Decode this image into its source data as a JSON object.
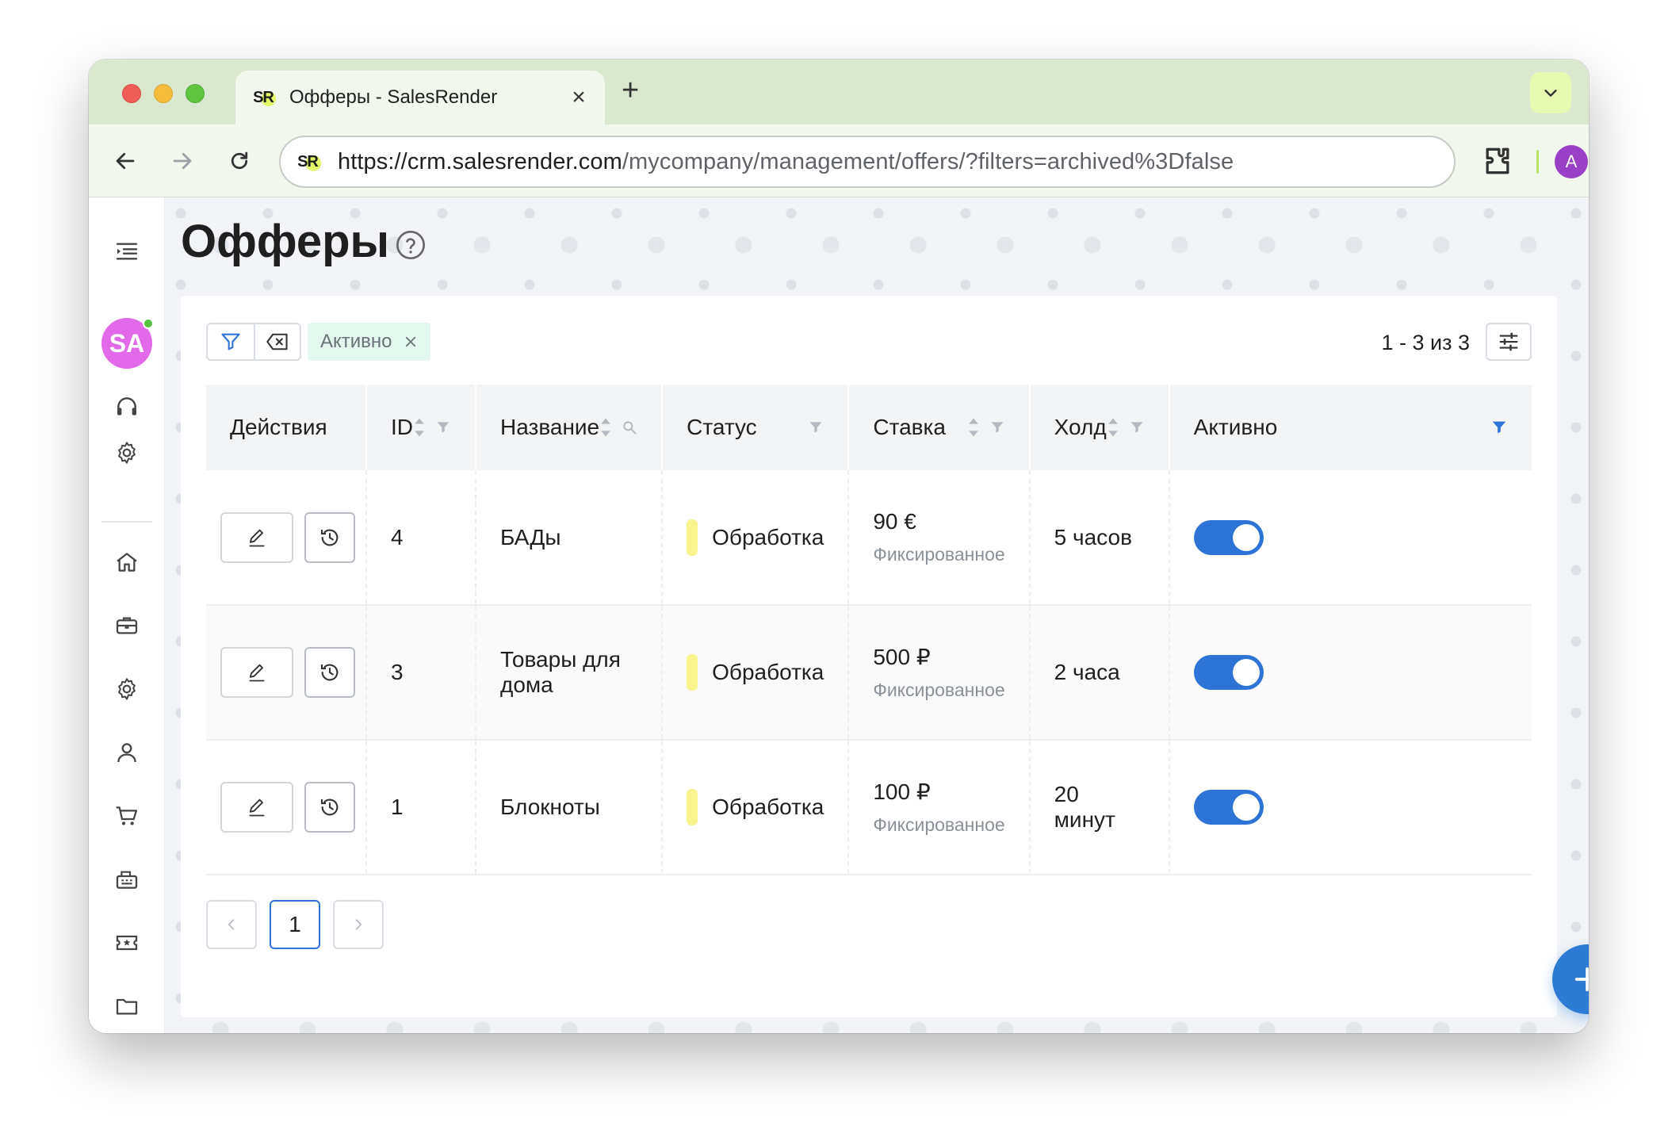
{
  "browser": {
    "tab_title": "Офферы - SalesRender",
    "tab_logo": "SR",
    "url_host": "https://crm.salesrender.com",
    "url_path": "/mycompany/management/offers/?filters=archived%3Dfalse",
    "profile_initial": "A",
    "icons": [
      "back-arrow-icon",
      "forward-arrow-icon",
      "reload-icon",
      "extensions-icon",
      "kebab-menu-icon",
      "chevron-down-icon",
      "close-icon",
      "plus-icon"
    ]
  },
  "sidebar": {
    "avatar_initials": "SA",
    "avatar_color": "#e06ae8",
    "online_color": "#52c23d",
    "items": [
      "menu-icon",
      "headset-icon",
      "gear-icon",
      "home-icon",
      "briefcase-icon",
      "gear-icon",
      "user-icon",
      "cart-icon",
      "register-icon",
      "ticket-icon",
      "folder-icon"
    ]
  },
  "page": {
    "title": "Офферы"
  },
  "toolbar": {
    "chip_label": "Активно",
    "range_text": "1 - 3 из 3"
  },
  "table": {
    "headers": {
      "actions": "Действия",
      "id": "ID",
      "name": "Название",
      "status": "Статус",
      "rate": "Ставка",
      "hold": "Холд",
      "active": "Активно"
    },
    "rows": [
      {
        "id": "4",
        "name": "БАДы",
        "status": "Обработка",
        "rate": "90 €",
        "rate_type": "Фиксированное",
        "hold": "5 часов",
        "active": true
      },
      {
        "id": "3",
        "name": "Товары для дома",
        "status": "Обработка",
        "rate": "500 ₽",
        "rate_type": "Фиксированное",
        "hold": "2 часа",
        "active": true
      },
      {
        "id": "1",
        "name": "Блокноты",
        "status": "Обработка",
        "rate": "100 ₽",
        "rate_type": "Фиксированное",
        "hold": "20 минут",
        "active": true
      }
    ]
  },
  "pagination": {
    "current_page": "1"
  },
  "colors": {
    "accent": "#2e74d6",
    "status_processing": "#f8f58d",
    "chip_bg": "#e4f7ef"
  }
}
